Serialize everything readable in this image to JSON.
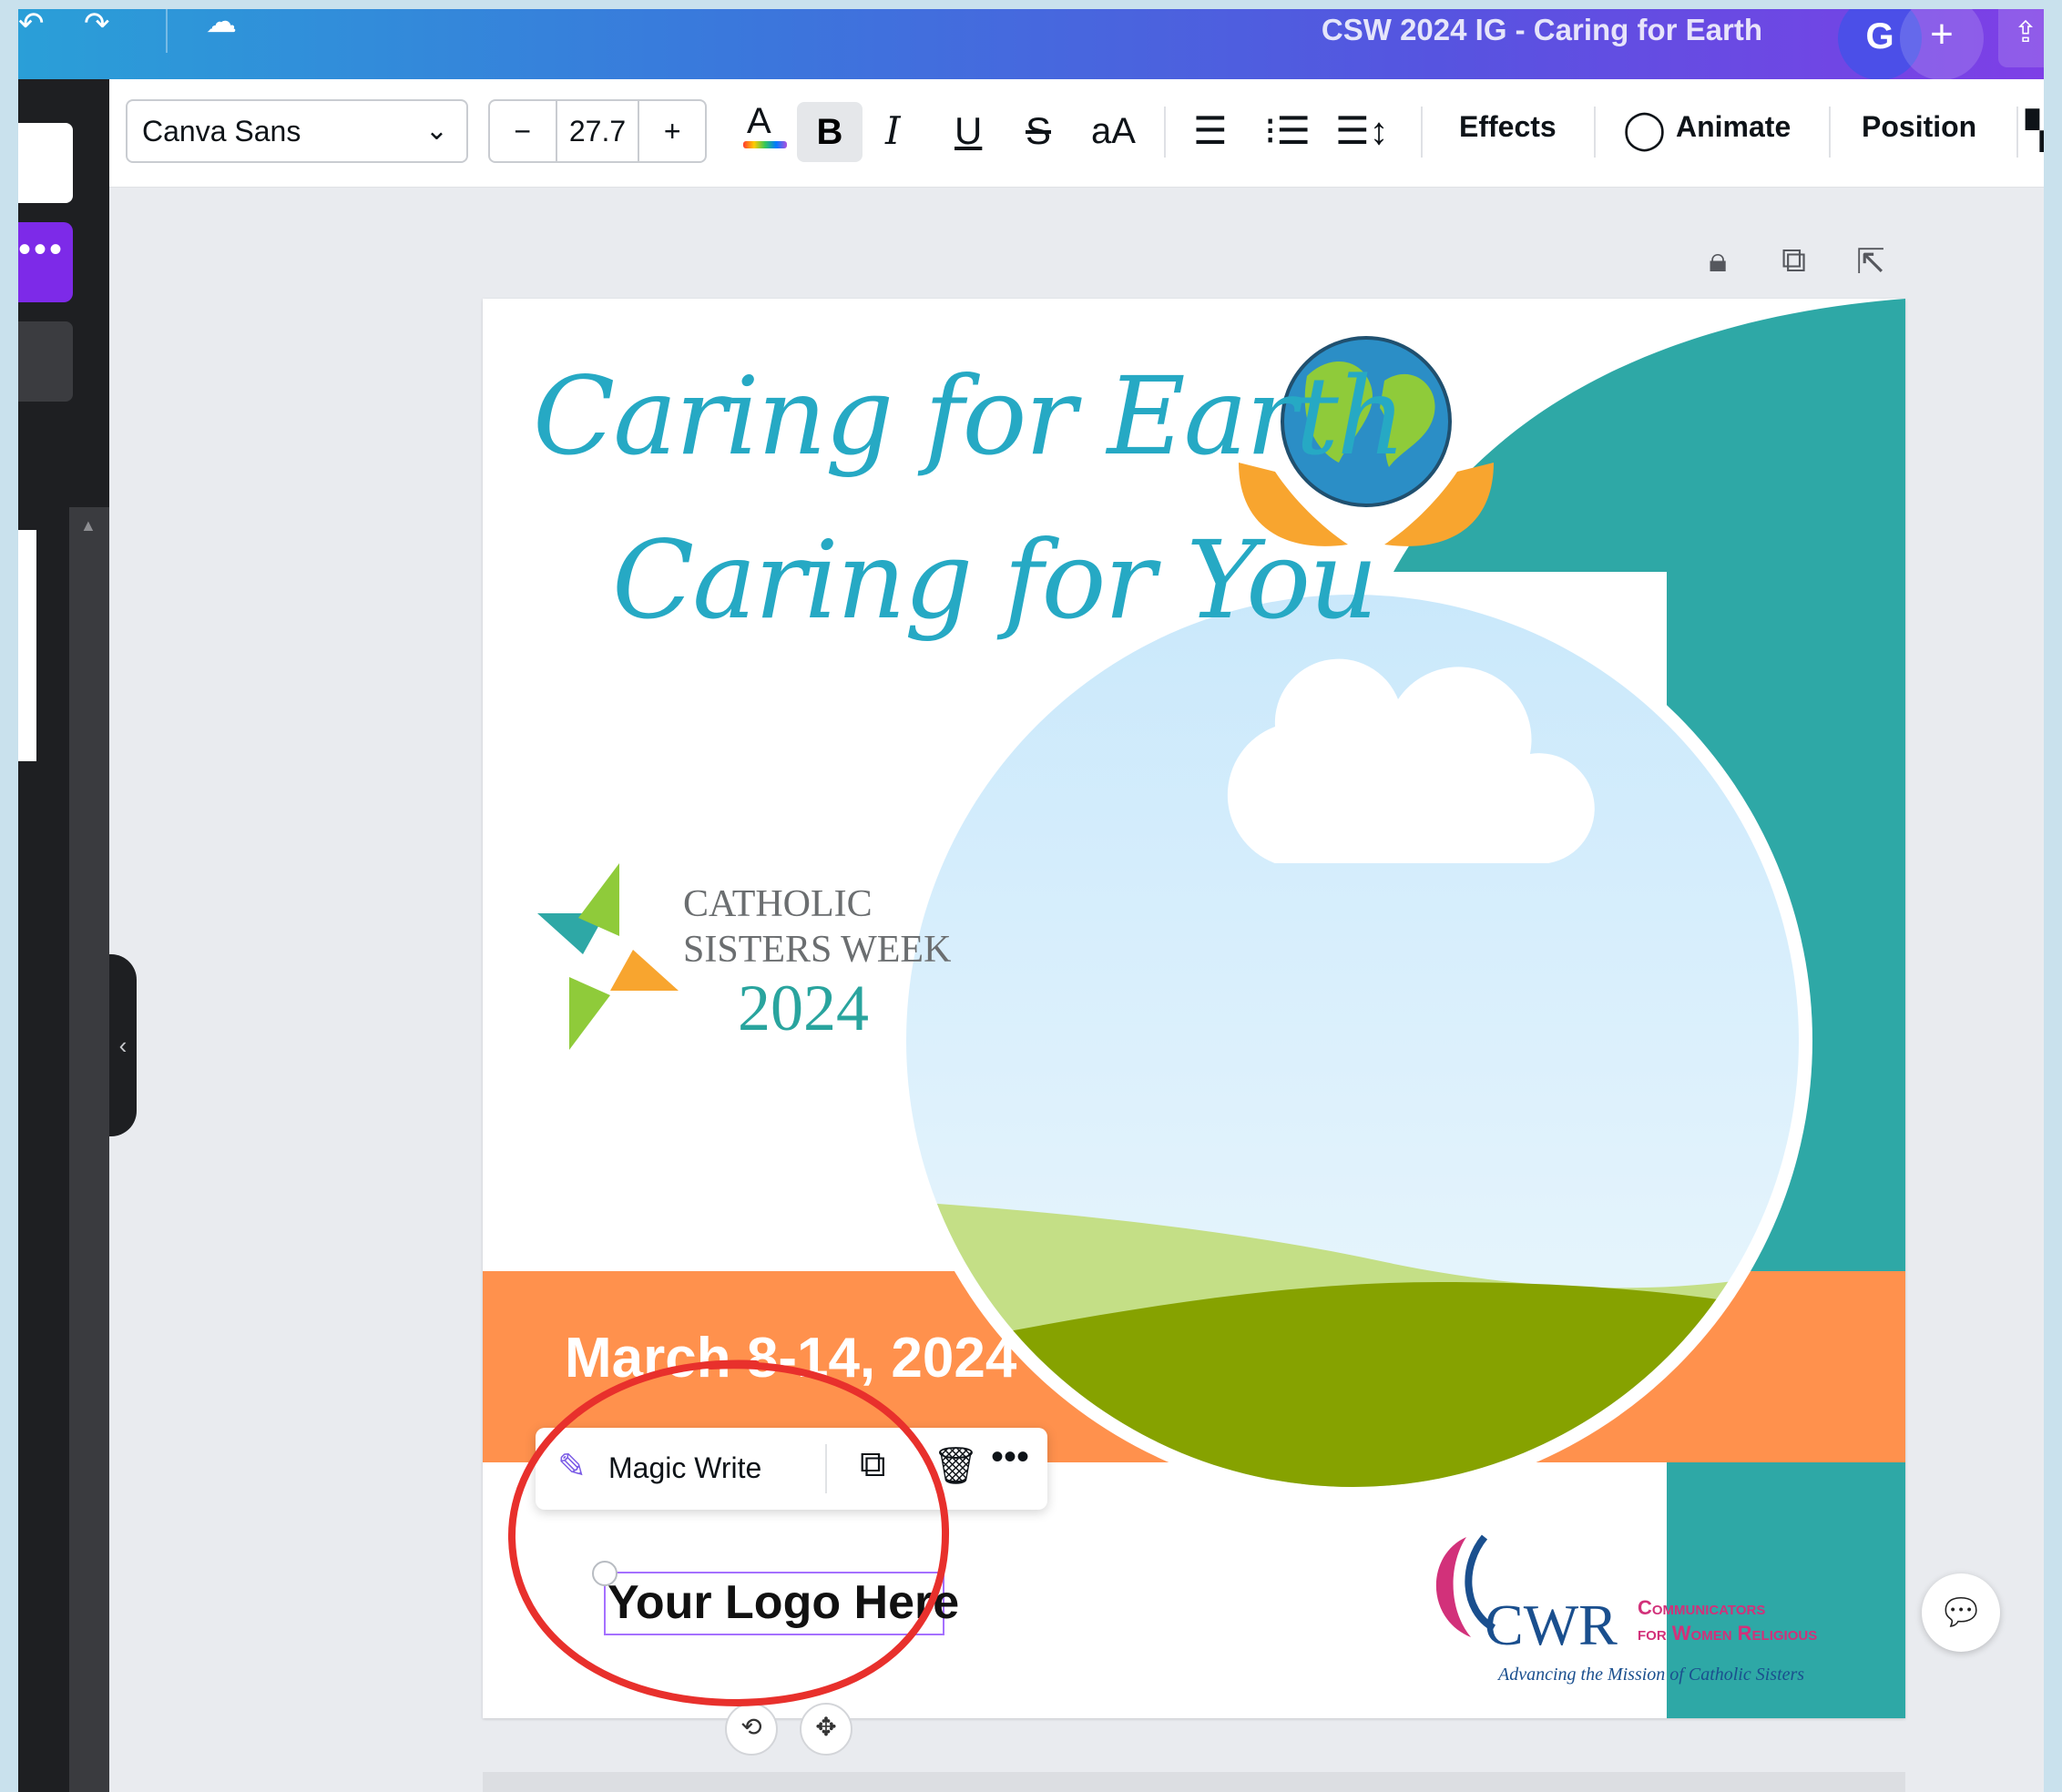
{
  "window": {
    "title": "CSW 2024 IG - Caring for Earth",
    "avatar_initial": "G",
    "plus": "+"
  },
  "topbar": {
    "more_dots": "•••"
  },
  "toolbar": {
    "font_family": "Canva Sans",
    "font_size": "27.7",
    "minus": "−",
    "plus": "+",
    "effects": "Effects",
    "animate": "Animate",
    "position": "Position"
  },
  "design": {
    "headline_1": "Caring for Earth",
    "headline_2": "Caring for You",
    "csw_line_1": "CATHOLIC",
    "csw_line_2": "SISTERS WEEK",
    "csw_year": "2024",
    "date": "March 8-14, 2024",
    "logo_placeholder": "Your Logo Here",
    "cwr_mark": "CWR",
    "cwr_line_1": "Communicators",
    "cwr_line_2": "for Women Religious",
    "cwr_tagline": "Advancing the Mission of Catholic Sisters"
  },
  "context_menu": {
    "magic_write": "Magic Write",
    "more": "•••"
  },
  "colors": {
    "accent_purple": "#7d2ae8",
    "teal": "#2ea8a6",
    "orange": "#ff914d",
    "highlight_red": "#e8302c"
  }
}
